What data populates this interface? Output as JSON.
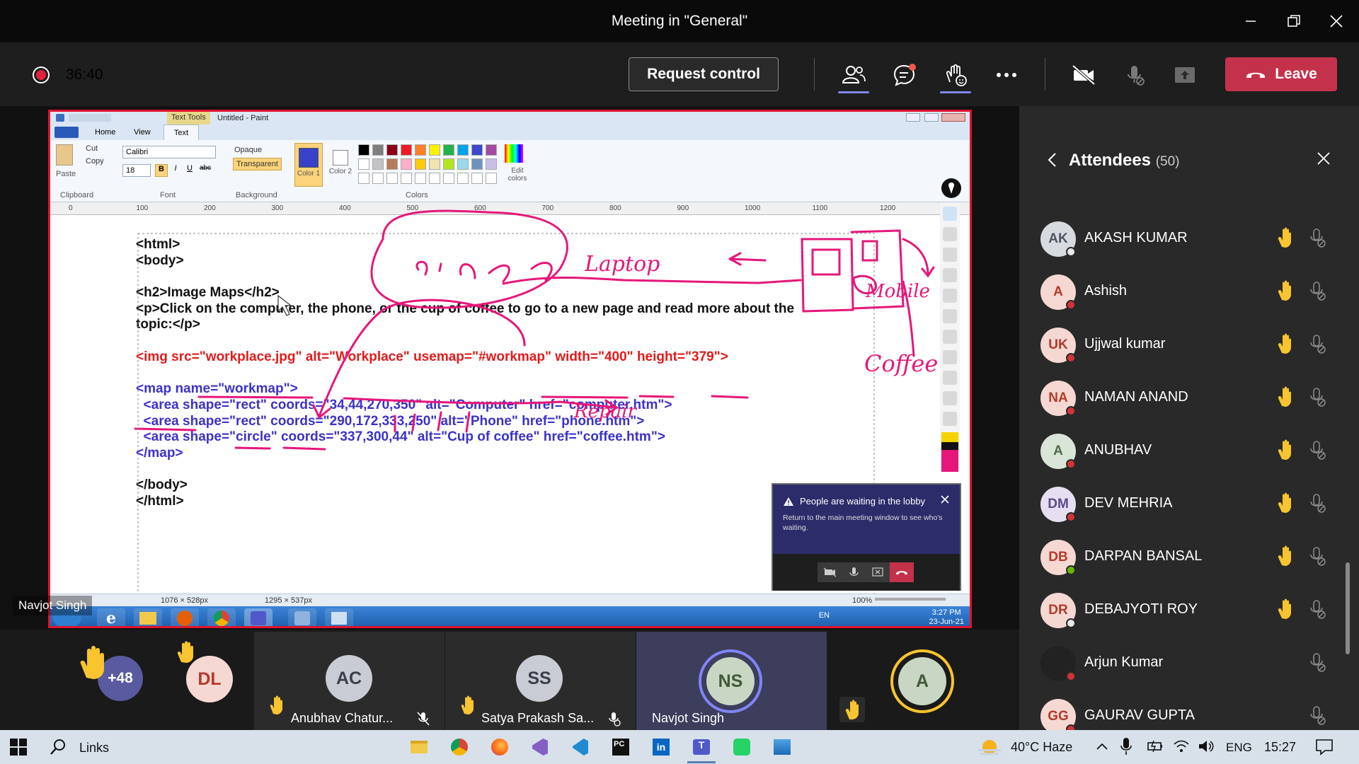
{
  "window": {
    "title": "Meeting in \"General\""
  },
  "toolbar": {
    "timer": "36:40",
    "request_control": "Request control",
    "leave": "Leave"
  },
  "paint": {
    "title_tab": "Text Tools",
    "title": "Untitled - Paint",
    "tabs": [
      "Home",
      "View",
      "Text"
    ],
    "clipboard": {
      "paste": "Paste",
      "cut": "Cut",
      "copy": "Copy",
      "group": "Clipboard"
    },
    "font": {
      "name": "Calibri",
      "size": "18",
      "group": "Font"
    },
    "background": {
      "opaque": "Opaque",
      "transparent": "Transparent",
      "group": "Background"
    },
    "colors": {
      "color1": "Color 1",
      "color2": "Color 2",
      "edit": "Edit colors",
      "group": "Colors"
    },
    "ruler": [
      "0",
      "100",
      "200",
      "300",
      "400",
      "500",
      "600",
      "700",
      "800",
      "900",
      "1000",
      "1100",
      "1200"
    ],
    "code_lines": [
      "<html>",
      "<body>",
      "",
      "<h2>Image Maps</h2>",
      "<p>Click on the computer, the phone, or the cup of coffee to go to a new page and read more about the",
      "topic:</p>",
      "",
      "<img src=\"workplace.jpg\" alt=\"Workplace\" usemap=\"#workmap\" width=\"400\" height=\"379\">",
      "",
      "<map name=\"workmap\">",
      "  <area shape=\"rect\" coords=\"34,44,270,350\" alt=\"Computer\" href=\"computer.htm\">",
      "  <area shape=\"rect\" coords=\"290,172,333,250\" alt=\"Phone\" href=\"phone.htm\">",
      "  <area shape=\"circle\" coords=\"337,300,44\" alt=\"Cup of coffee\" href=\"coffee.htm\">",
      "</map>",
      "",
      "</body>",
      "</html>"
    ],
    "status_selection": "1076 × 528px",
    "status_canvas": "1295 × 537px",
    "zoom": "100%",
    "annotation_words": [
      "Laptop",
      "Mobile",
      "Coffee",
      "Repair"
    ],
    "win7_tray": {
      "lang": "EN",
      "time": "3:27 PM",
      "date": "23-Jun-21"
    }
  },
  "toast": {
    "title": "People are waiting in the lobby",
    "message": "Return to the main meeting window to see who's waiting."
  },
  "presenter_label": "Navjot Singh",
  "strip": {
    "overflow_count": "+48",
    "tiles": [
      {
        "initials": "DL",
        "name": ""
      },
      {
        "initials": "AC",
        "name": "Anubhav Chatur..."
      },
      {
        "initials": "SS",
        "name": "Satya Prakash Sa..."
      },
      {
        "initials": "NS",
        "name": "Navjot Singh"
      },
      {
        "initials": "A",
        "name": ""
      }
    ]
  },
  "attendees": {
    "title": "Attendees",
    "count": "(50)",
    "list": [
      {
        "initials": "AK",
        "name": "AKASH KUMAR",
        "bg": "#d7dbe0",
        "fg": "#4b5563",
        "status": "#e8e8e8",
        "hand": true
      },
      {
        "initials": "A",
        "name": "Ashish",
        "bg": "#f6d8d3",
        "fg": "#b33a2a",
        "status": "#d13438",
        "hand": true
      },
      {
        "initials": "UK",
        "name": "Ujjwal kumar",
        "bg": "#f6d8d3",
        "fg": "#b33a2a",
        "status": "#d13438",
        "hand": true
      },
      {
        "initials": "NA",
        "name": "NAMAN ANAND",
        "bg": "#f6d8d3",
        "fg": "#b33a2a",
        "status": "#d13438",
        "hand": true
      },
      {
        "initials": "A",
        "name": "ANUBHAV",
        "bg": "#d9e5d7",
        "fg": "#4e6b47",
        "status": "#d13438",
        "hand": true
      },
      {
        "initials": "DM",
        "name": "DEV MEHRIA",
        "bg": "#e6dff2",
        "fg": "#5b4a8b",
        "status": "#d13438",
        "hand": true
      },
      {
        "initials": "DB",
        "name": "DARPAN BANSAL",
        "bg": "#f6d8d3",
        "fg": "#b33a2a",
        "status": "#6bb700",
        "hand": true
      },
      {
        "initials": "DR",
        "name": "DEBAJYOTI ROY",
        "bg": "#f6d8d3",
        "fg": "#b33a2a",
        "status": "#e8e8e8",
        "hand": true
      },
      {
        "initials": "",
        "name": "Arjun Kumar",
        "bg": "#222222",
        "fg": "#ffffff",
        "status": "#d13438",
        "hand": false
      },
      {
        "initials": "GG",
        "name": "GAURAV GUPTA",
        "bg": "#f6d8d3",
        "fg": "#b33a2a",
        "status": "#d13438",
        "hand": false
      }
    ]
  },
  "taskbar": {
    "search_label": "Links",
    "weather": "40°C  Haze",
    "lang": "ENG",
    "time": "15:27"
  },
  "colors": {
    "accent": "#7f85f5",
    "leave": "#c4314b",
    "ink": "#e5177a",
    "hand": "#f8c42f"
  }
}
